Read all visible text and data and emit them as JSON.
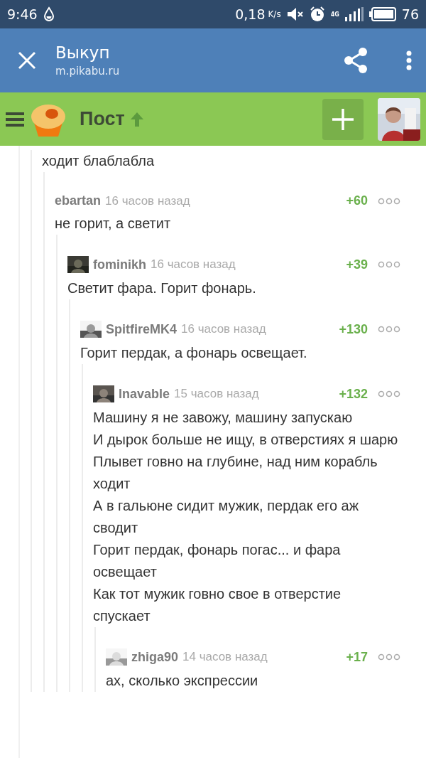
{
  "status_bar": {
    "time": "9:46",
    "speed": "0,18",
    "speed_unit": "K/s",
    "network": "4G",
    "battery": "76"
  },
  "app_bar": {
    "title": "Выкуп",
    "url": "m.pikabu.ru"
  },
  "site_bar": {
    "title": "Пост"
  },
  "comments": [
    {
      "kind": "fragment",
      "body": [
        "ходит блаблабла"
      ],
      "children": [
        {
          "kind": "comment",
          "user": "ebartan",
          "avatar": false,
          "time": "16 часов назад",
          "score": "+60",
          "body": [
            "не горит, а светит"
          ],
          "children": [
            {
              "kind": "comment",
              "user": "fominikh",
              "avatar": true,
              "time": "16 часов назад",
              "score": "+39",
              "body": [
                "Светит фара. Горит фонарь."
              ],
              "children": [
                {
                  "kind": "comment",
                  "user": "SpitfireMK4",
                  "avatar": true,
                  "time": "16 часов назад",
                  "score": "+130",
                  "body": [
                    "Горит пердак, а фонарь освещает."
                  ],
                  "children": [
                    {
                      "kind": "comment",
                      "user": "lnavable",
                      "avatar": true,
                      "time": "15 часов назад",
                      "score": "+132",
                      "body": [
                        "Машину я не завожу, машину запускаю",
                        "И дырок больше не ищу, в отверстиях я шарю",
                        "Плывет говно на глубине, над ним корабль ходит",
                        "А в гальюне сидит мужик, пердак его аж сводит",
                        "Горит пердак, фонарь погас... и фара освещает",
                        "Как тот мужик  говно свое в отверстие спускает"
                      ],
                      "children": [
                        {
                          "kind": "comment",
                          "user": "zhiga90",
                          "avatar": true,
                          "time": "14 часов назад",
                          "score": "+17",
                          "body": [
                            "ах, сколько экспрессии"
                          ]
                        }
                      ]
                    }
                  ]
                }
              ]
            }
          ]
        }
      ]
    }
  ]
}
